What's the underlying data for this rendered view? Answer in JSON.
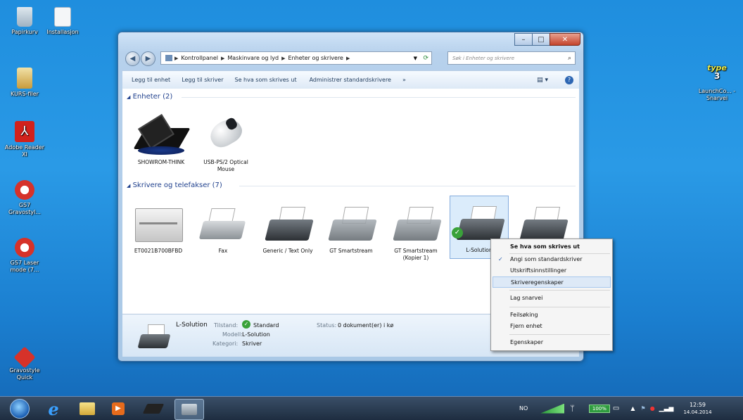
{
  "desktop": {
    "icons": [
      {
        "label": "Papirkurv"
      },
      {
        "label": "Installasjon"
      },
      {
        "label": "KURS-filer"
      },
      {
        "label": "Adobe Reader XI"
      },
      {
        "label": "GS7 Gravostyl..."
      },
      {
        "label": "GS7 Laser mode (7..."
      },
      {
        "label": "Gravostyle Quick"
      },
      {
        "label": "LaunchCo... - Snarvei"
      }
    ]
  },
  "window": {
    "breadcrumb": [
      "Kontrollpanel",
      "Maskinvare og lyd",
      "Enheter og skrivere"
    ],
    "search_placeholder": "Søk i Enheter og skrivere",
    "toolbar": {
      "add_device": "Legg til enhet",
      "add_printer": "Legg til skriver",
      "see_printing": "Se hva som skrives ut",
      "manage_default": "Administrer standardskrivere",
      "more": "»"
    },
    "groups": {
      "devices": "Enheter (2)",
      "printers": "Skrivere og telefakser (7)"
    },
    "devices": [
      {
        "label": "SHOWROM-THINK"
      },
      {
        "label": "USB-PS/2 Optical Mouse"
      }
    ],
    "printers": [
      {
        "label": "ET0021B700BFBD"
      },
      {
        "label": "Fax"
      },
      {
        "label": "Generic / Text Only"
      },
      {
        "label": "GT Smartstream"
      },
      {
        "label": "GT Smartstream (Kopier 1)"
      },
      {
        "label": "L-Solution"
      },
      {
        "label": ""
      }
    ],
    "details": {
      "name": "L-Solution",
      "state_label": "Tilstand:",
      "state_value": "Standard",
      "model_label": "Modell:",
      "model_value": "L-Solution",
      "category_label": "Kategori:",
      "category_value": "Skriver",
      "status_label": "Status:",
      "status_value": "0 dokument(er) i kø"
    }
  },
  "context_menu": {
    "items": [
      {
        "label": "Se hva som skrives ut"
      },
      {
        "label": "Angi som standardskriver"
      },
      {
        "label": "Utskriftsinnstillinger"
      },
      {
        "label": "Skriveregenskaper"
      },
      {
        "label": "Lag snarvei"
      },
      {
        "label": "Feilsøking"
      },
      {
        "label": "Fjern enhet"
      },
      {
        "label": "Egenskaper"
      }
    ]
  },
  "taskbar": {
    "language": "NO",
    "battery": "100%",
    "time": "12:59",
    "date": "14.04.2014"
  }
}
